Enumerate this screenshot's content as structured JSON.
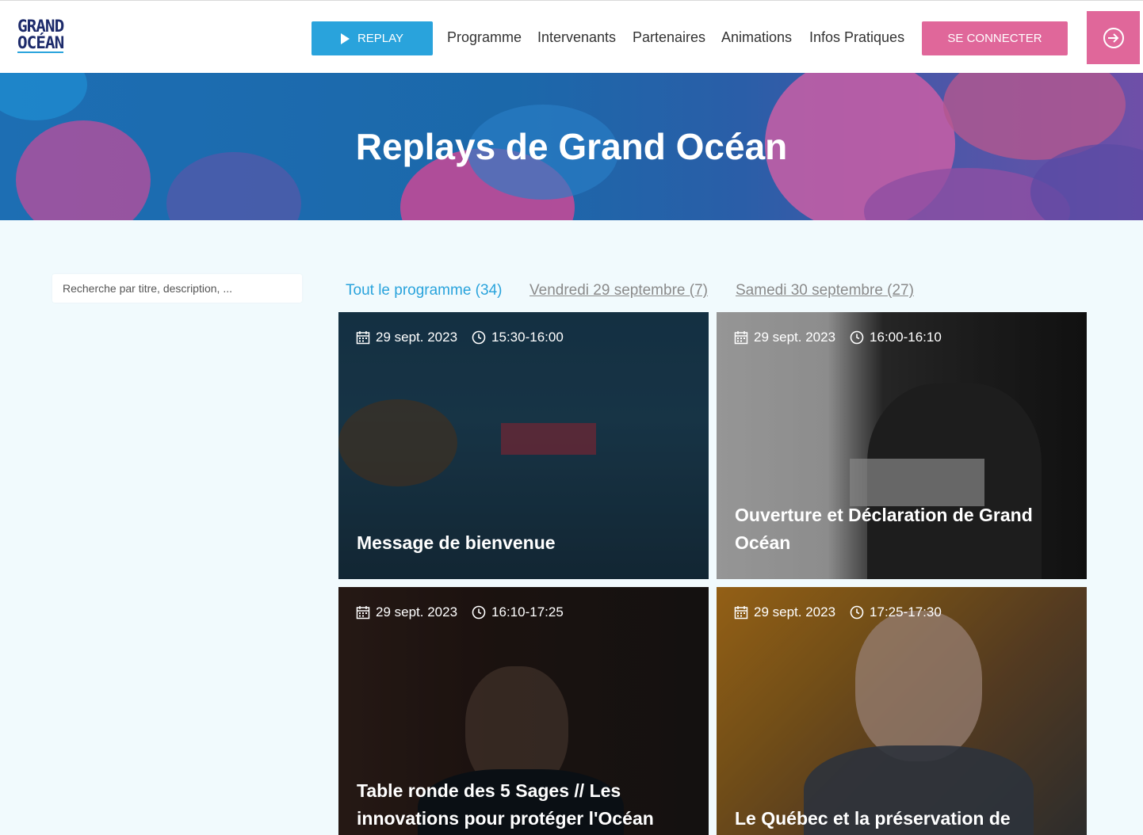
{
  "header": {
    "logo_line1": "GRAND",
    "logo_line2": "OCÉAN",
    "replay_label": "REPLAY",
    "nav": [
      "Programme",
      "Intervenants",
      "Partenaires",
      "Animations",
      "Infos Pratiques"
    ],
    "connect_label": "SE CONNECTER"
  },
  "hero": {
    "title": "Replays de Grand Océan"
  },
  "search": {
    "placeholder": "Recherche par titre, description, ..."
  },
  "filters": [
    {
      "label": "Tout le programme (34)",
      "active": true
    },
    {
      "label": "Vendredi 29 septembre (7)",
      "active": false
    },
    {
      "label": "Samedi 30 septembre (27)",
      "active": false
    }
  ],
  "cards": [
    {
      "date": "29 sept. 2023",
      "time": "15:30-16:00",
      "title": "Message de bienvenue"
    },
    {
      "date": "29 sept. 2023",
      "time": "16:00-16:10",
      "title": "Ouverture et Déclaration de Grand Océan"
    },
    {
      "date": "29 sept. 2023",
      "time": "16:10-17:25",
      "title": "Table ronde des 5 Sages // Les innovations pour protéger l'Océan"
    },
    {
      "date": "29 sept. 2023",
      "time": "17:25-17:30",
      "title": "Le Québec et la préservation de l’océan"
    }
  ],
  "colors": {
    "accent_blue": "#29a3dc",
    "accent_pink": "#e0679a",
    "navy": "#1d2b6b"
  }
}
